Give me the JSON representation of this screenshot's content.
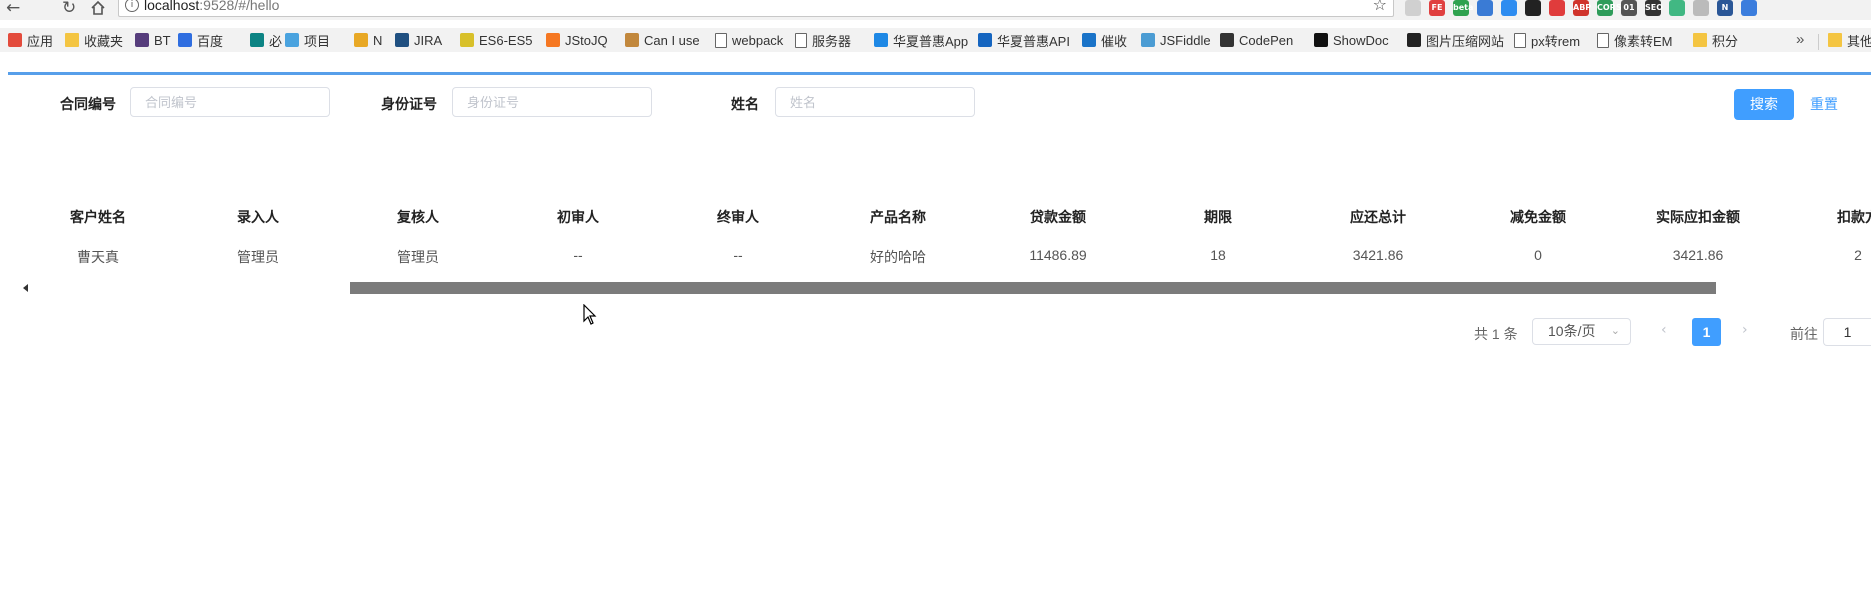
{
  "browser": {
    "url_host": "localhost",
    "url_path": ":9528/#/hello",
    "back_icon": "arrow-left-icon",
    "reload_icon": "reload-icon",
    "home_icon": "home-icon"
  },
  "extensions": [
    {
      "name": "ext-1",
      "text": "",
      "color": "#d0d0d0"
    },
    {
      "name": "ext-2",
      "text": "FE",
      "color": "#e04040"
    },
    {
      "name": "ext-3",
      "text": "beta",
      "color": "#2fa24f"
    },
    {
      "name": "ext-4",
      "text": "",
      "color": "#3a7bd5"
    },
    {
      "name": "ext-5",
      "text": "",
      "color": "#2d8cf0"
    },
    {
      "name": "ext-6",
      "text": "",
      "color": "#222222"
    },
    {
      "name": "ext-7",
      "text": "",
      "color": "#e03c3c"
    },
    {
      "name": "ext-8",
      "text": "ABP",
      "color": "#d0342c"
    },
    {
      "name": "ext-9",
      "text": "CORS",
      "color": "#2e9c5a"
    },
    {
      "name": "ext-10",
      "text": "01",
      "color": "#555555"
    },
    {
      "name": "ext-11",
      "text": "SEO",
      "color": "#333333"
    },
    {
      "name": "ext-12",
      "text": "",
      "color": "#41b883"
    },
    {
      "name": "ext-13",
      "text": "",
      "color": "#bbbbbb"
    },
    {
      "name": "ext-14",
      "text": "N",
      "color": "#2b5797"
    },
    {
      "name": "ext-15",
      "text": "",
      "color": "#3b7ddd"
    }
  ],
  "bookmarks": [
    {
      "label": "应用",
      "icon": "apps-grid-icon",
      "color": "#e34b3c"
    },
    {
      "label": "收藏夹",
      "icon": "folder-icon",
      "color": "#f4c542"
    },
    {
      "label": "BT",
      "icon": "bootstrap-icon",
      "color": "#563d7c"
    },
    {
      "label": "百度",
      "icon": "baidu-paw-icon",
      "color": "#2f6ee0"
    },
    {
      "label": "必",
      "icon": "bing-icon",
      "color": "#0c8484"
    },
    {
      "label": "项目",
      "icon": "project-icon",
      "color": "#4aa3df"
    },
    {
      "label": "N",
      "icon": "chrome-icon",
      "color": "#e8a825"
    },
    {
      "label": "JIRA",
      "icon": "jira-icon",
      "color": "#205081"
    },
    {
      "label": "ES6-ES5",
      "icon": "babel-icon",
      "color": "#d8c02a"
    },
    {
      "label": "JStoJQ",
      "icon": "hubspot-icon",
      "color": "#f57722"
    },
    {
      "label": "Can I use",
      "icon": "caniuse-icon",
      "color": "#c2883d"
    },
    {
      "label": "webpack",
      "icon": "document-icon",
      "color": "#ffffff"
    },
    {
      "label": "服务器",
      "icon": "document-icon",
      "color": "#ffffff"
    },
    {
      "label": "华夏普惠App",
      "icon": "app-icon",
      "color": "#1e88e5"
    },
    {
      "label": "华夏普惠API",
      "icon": "api-icon",
      "color": "#1565c0"
    },
    {
      "label": "催收",
      "icon": "a-circle-icon",
      "color": "#1a73c8"
    },
    {
      "label": "JSFiddle",
      "icon": "cloud-icon",
      "color": "#4b9cd3"
    },
    {
      "label": "CodePen",
      "icon": "codepen-icon",
      "color": "#333333"
    },
    {
      "label": "ShowDoc",
      "icon": "showdoc-icon",
      "color": "#111111"
    },
    {
      "label": "图片压缩网站",
      "icon": "panda-icon",
      "color": "#222222"
    },
    {
      "label": "px转rem",
      "icon": "document-icon",
      "color": "#ffffff"
    },
    {
      "label": "像素转EM",
      "icon": "document-icon",
      "color": "#ffffff"
    },
    {
      "label": "积分",
      "icon": "folder-icon",
      "color": "#f4c542"
    },
    {
      "label": "其他",
      "icon": "folder-icon",
      "color": "#f4c542"
    }
  ],
  "search": {
    "contract_label": "合同编号",
    "contract_placeholder": "合同编号",
    "idcard_label": "身份证号",
    "idcard_placeholder": "身份证号",
    "name_label": "姓名",
    "name_placeholder": "姓名",
    "search_button": "搜索",
    "reset_button": "重置"
  },
  "table": {
    "columns": [
      "客户姓名",
      "录入人",
      "复核人",
      "初审人",
      "终审人",
      "产品名称",
      "贷款金额",
      "期限",
      "应还总计",
      "减免金额",
      "实际应扣金额",
      "扣款方"
    ],
    "rows": [
      [
        "曹天真",
        "管理员",
        "管理员",
        "--",
        "--",
        "好的哈哈",
        "11486.89",
        "18",
        "3421.86",
        "0",
        "3421.86",
        "2"
      ]
    ]
  },
  "pagination": {
    "total": "共 1 条",
    "page_size": "10条/页",
    "current_page": "1",
    "goto_label": "前往",
    "goto_value": "1"
  }
}
